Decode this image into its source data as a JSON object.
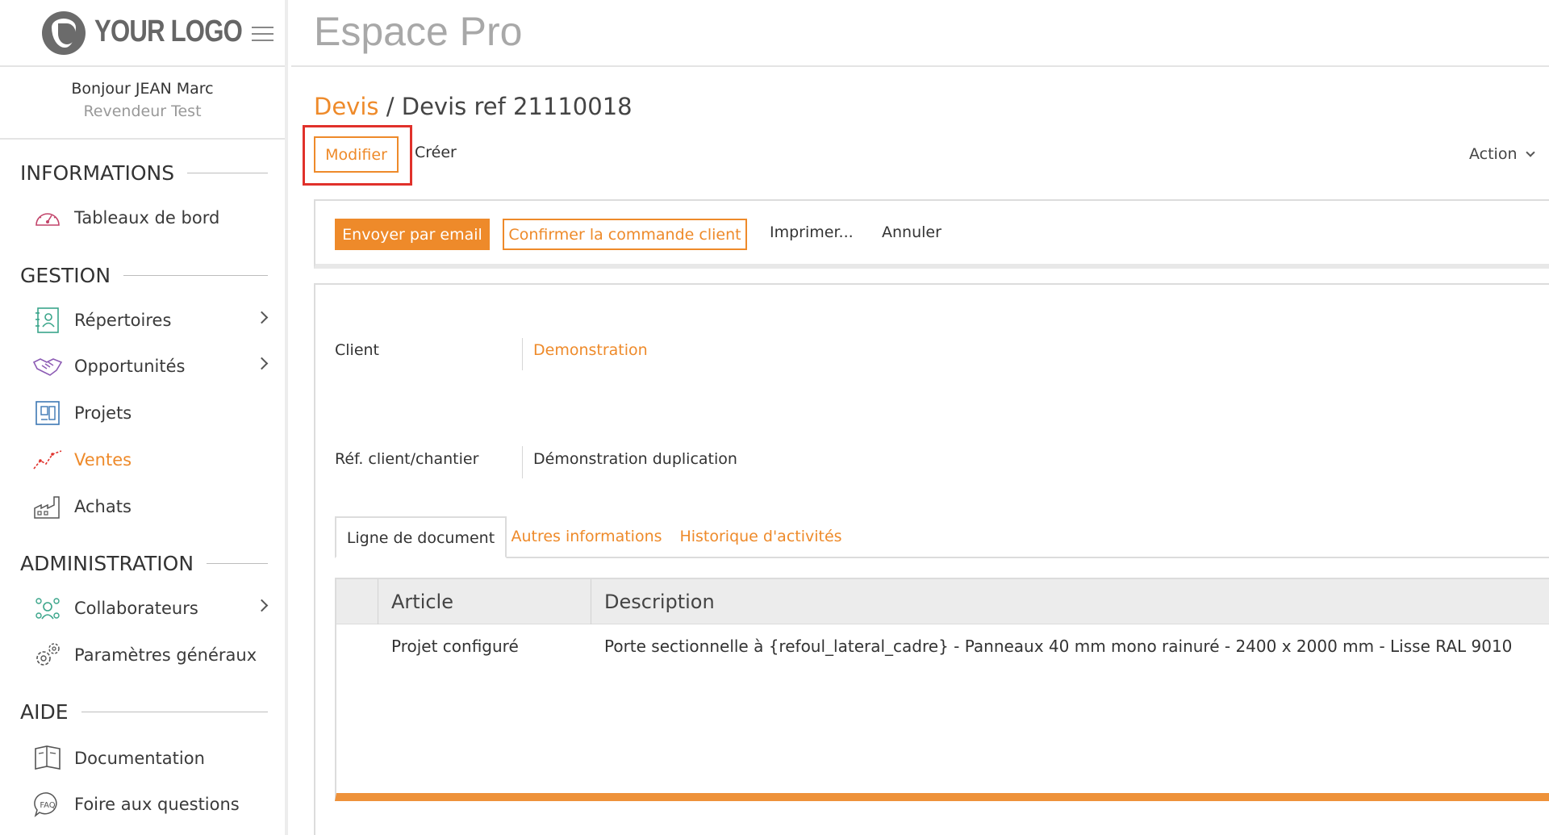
{
  "logo": {
    "text": "YOUR LOGO"
  },
  "user": {
    "greeting": "Bonjour JEAN Marc",
    "role": "Revendeur Test"
  },
  "sidebar": {
    "sections": [
      {
        "title": "INFORMATIONS"
      },
      {
        "title": "GESTION"
      },
      {
        "title": "ADMINISTRATION"
      },
      {
        "title": "AIDE"
      }
    ],
    "items": [
      {
        "label": "Tableaux de bord",
        "icon": "dashboard-gauge-icon"
      },
      {
        "label": "Répertoires",
        "icon": "contacts-book-icon"
      },
      {
        "label": "Opportunités",
        "icon": "handshake-icon"
      },
      {
        "label": "Projets",
        "icon": "blueprint-icon"
      },
      {
        "label": "Ventes",
        "icon": "sales-chart-icon",
        "active": true
      },
      {
        "label": "Achats",
        "icon": "factory-icon"
      },
      {
        "label": "Collaborateurs",
        "icon": "team-icon"
      },
      {
        "label": "Paramètres généraux",
        "icon": "gears-icon"
      },
      {
        "label": "Documentation",
        "icon": "book-icon"
      },
      {
        "label": "Foire aux questions",
        "icon": "faq-icon"
      }
    ]
  },
  "header": {
    "title": "Espace Pro"
  },
  "breadcrumb": {
    "parent": "Devis",
    "separator": " / ",
    "current": "Devis ref 21110018"
  },
  "toolbar": {
    "modifier": "Modifier",
    "creer": "Créer",
    "action": "Action"
  },
  "actions": {
    "email": "Envoyer par email",
    "confirm": "Confirmer la commande client",
    "print": "Imprimer...",
    "cancel": "Annuler"
  },
  "fields": {
    "client_label": "Client",
    "client_value": "Demonstration",
    "ref_label": "Réf. client/chantier",
    "ref_value": "Démonstration duplication"
  },
  "tabs": [
    {
      "label": "Ligne de document",
      "active": true
    },
    {
      "label": "Autres informations"
    },
    {
      "label": "Historique d'activités"
    }
  ],
  "table": {
    "columns": [
      "Article",
      "Description"
    ],
    "rows": [
      {
        "article": "Projet configuré",
        "description": "Porte sectionnelle à {refoul_lateral_cadre} - Panneaux 40 mm mono rainuré - 2400 x 2000 mm - Lisse RAL 9010"
      }
    ]
  },
  "colors": {
    "accent": "#ee8a2a",
    "highlight": "#e0312b",
    "muted": "#a8a8a8"
  }
}
